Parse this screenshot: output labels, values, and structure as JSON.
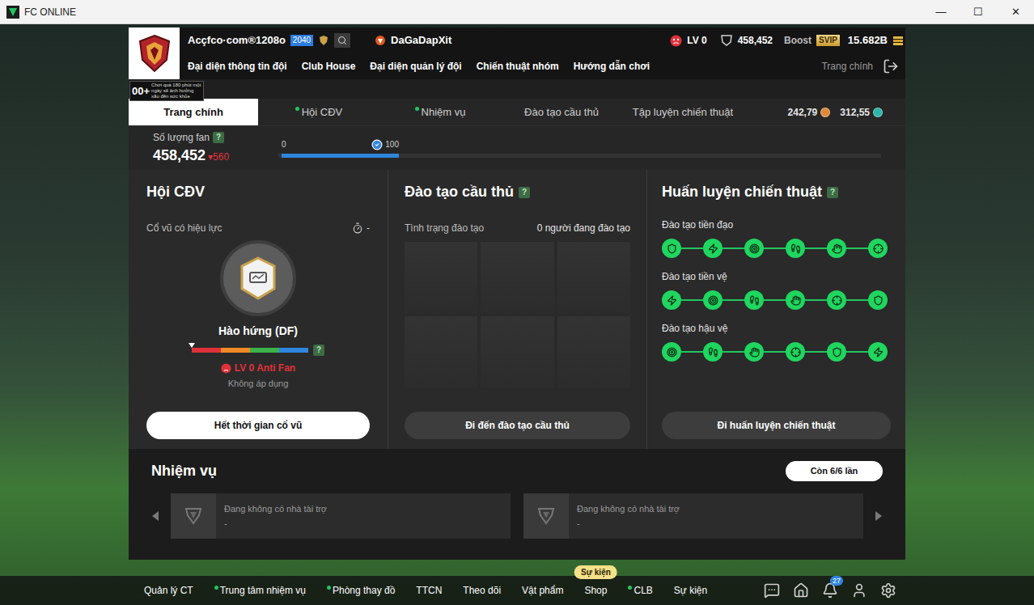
{
  "window": {
    "title": "FC ONLINE",
    "controls": [
      "—",
      "☐",
      "✕"
    ]
  },
  "header": {
    "club_name": "Acçfco·com®1208o",
    "club_rank": "2040",
    "team_name": "DaGaDapXit",
    "level": "LV 0",
    "fans": "458,452",
    "boost": "Boost",
    "vip": "SVIP",
    "coins": "15.682B",
    "menu": [
      "Đại diện thông tin đội",
      "Club House",
      "Đại diện quản lý đội",
      "Chiến thuật nhóm",
      "Hướng dẫn chơi"
    ],
    "home": "Trang chính"
  },
  "age_notice": {
    "rating": "00+",
    "text": "Chơi quá 180 phút một ngày sẽ ảnh hưởng xấu đến sức khỏe"
  },
  "tabs": [
    {
      "label": "Trang chính",
      "selected": true,
      "dot": false
    },
    {
      "label": "Hội CĐV",
      "selected": false,
      "dot": true
    },
    {
      "label": "Nhiệm vụ",
      "selected": false,
      "dot": true
    },
    {
      "label": "Đào tạo cầu thủ",
      "selected": false,
      "dot": false
    },
    {
      "label": "Tập luyện chiến thuật",
      "selected": false,
      "dot": false
    }
  ],
  "currencies": [
    {
      "value": "242,79",
      "color": "#e0893a"
    },
    {
      "value": "312,55",
      "color": "#2bb5a8"
    }
  ],
  "help": "?",
  "fans": {
    "label": "Số lượng fan",
    "value": "458,452",
    "change_arrow": "▾",
    "change": "560",
    "bar_min": "0",
    "bar_max": "100",
    "level": 1,
    "complete": true
  },
  "supporters": {
    "title": "Hội CĐV",
    "effect_label": "Cổ vũ có hiệu lực",
    "timer": "-",
    "mood": "Hào hứng (DF)",
    "segments": [
      {
        "color": "#e0313b",
        "share": 0.25
      },
      {
        "color": "#f08a24",
        "share": 0.25
      },
      {
        "color": "#3cb34a",
        "share": 0.25
      },
      {
        "color": "#2e86de",
        "share": 0.25
      }
    ],
    "level": 0,
    "rank": "LV 0 Anti Fan",
    "rank_note": "Không áp dụng",
    "button": "Hết thời gian cổ vũ"
  },
  "training": {
    "title": "Đào tạo cầu thủ",
    "status_label": "Tình trạng đào tạo",
    "count": "0 người đang đào tạo",
    "slots": [
      {
        "occupied": false
      },
      {
        "occupied": false
      },
      {
        "occupied": false
      },
      {
        "occupied": false
      },
      {
        "occupied": false
      },
      {
        "occupied": false
      }
    ],
    "button": "Đi đến đào tạo cầu thủ"
  },
  "tactics": {
    "title": "Huấn luyện chiến thuật",
    "rows": [
      {
        "label": "Đào tạo tiền đạo",
        "nodes": [
          {
            "unlocked": true
          },
          {
            "unlocked": true
          },
          {
            "unlocked": true
          },
          {
            "unlocked": true
          },
          {
            "unlocked": true
          },
          {
            "unlocked": true
          }
        ]
      },
      {
        "label": "Đào tạo tiền vệ",
        "nodes": [
          {
            "unlocked": true
          },
          {
            "unlocked": true
          },
          {
            "unlocked": true
          },
          {
            "unlocked": true
          },
          {
            "unlocked": true
          },
          {
            "unlocked": true
          }
        ]
      },
      {
        "label": "Đào tạo hậu vệ",
        "nodes": [
          {
            "unlocked": true
          },
          {
            "unlocked": true
          },
          {
            "unlocked": true
          },
          {
            "unlocked": true
          },
          {
            "unlocked": true
          },
          {
            "unlocked": true
          }
        ]
      }
    ],
    "button": "Đi huấn luyện chiến thuật"
  },
  "missions": {
    "title": "Nhiệm vụ",
    "remaining": "Còn 6/6 lần",
    "cards": [
      {
        "title": "Đang không có nhà tài trợ",
        "detail": "-"
      },
      {
        "title": "Đang không có nhà tài trợ",
        "detail": "-"
      }
    ]
  },
  "bottom_nav": {
    "items": [
      {
        "label": "Quản lý CT",
        "dot": false
      },
      {
        "label": "Trung tâm nhiệm vụ",
        "dot": true
      },
      {
        "label": "Phòng thay đồ",
        "dot": true
      },
      {
        "label": "TTCN",
        "dot": false
      },
      {
        "label": "Theo dõi",
        "dot": false
      },
      {
        "label": "Vật phẩm",
        "dot": false
      },
      {
        "label": "Shop",
        "dot": false,
        "badge": "Sự kiện"
      },
      {
        "label": "CLB",
        "dot": true
      },
      {
        "label": "Sự kiện",
        "dot": false
      }
    ],
    "notifications": "27"
  }
}
